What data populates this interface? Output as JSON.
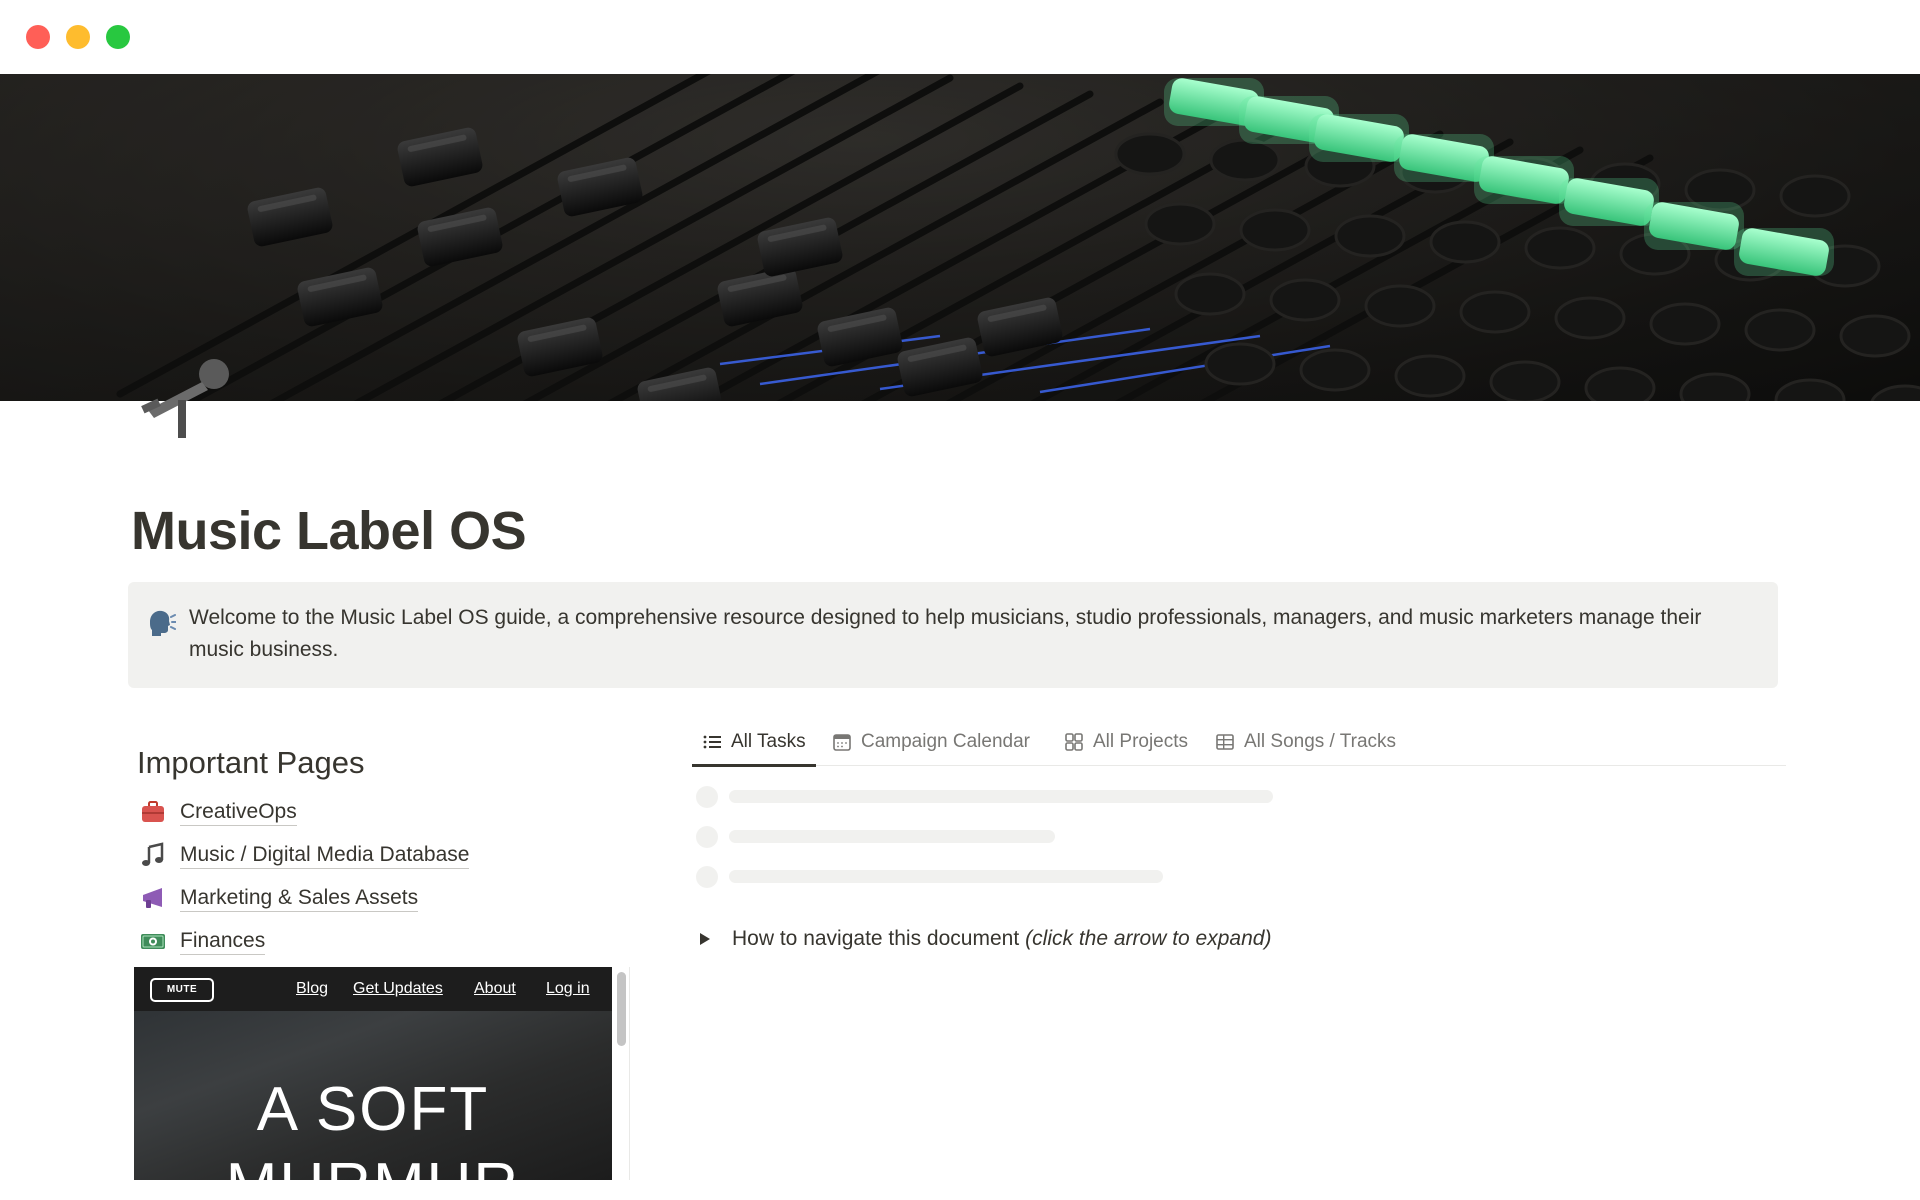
{
  "window": {
    "controls": [
      "close",
      "minimize",
      "zoom"
    ]
  },
  "cover": {
    "icon": "mixing-console-cover"
  },
  "page": {
    "icon": "microphone-icon",
    "title": "Music Label OS"
  },
  "callout": {
    "icon": "speaking-head-icon",
    "text": "Welcome to the Music Label OS guide, a comprehensive resource designed to help musicians, studio professionals, managers, and music marketers manage their music business."
  },
  "important_pages": {
    "heading": "Important Pages",
    "items": [
      {
        "icon": "briefcase-icon",
        "label": "CreativeOps"
      },
      {
        "icon": "musical-note-icon",
        "label": "Music / Digital Media Database"
      },
      {
        "icon": "megaphone-icon",
        "label": "Marketing & Sales Assets"
      },
      {
        "icon": "dollar-banknote-icon",
        "label": "Finances"
      }
    ]
  },
  "embed": {
    "logo": "MUTE",
    "nav": [
      "Blog",
      "Get Updates",
      "About",
      "Log in"
    ],
    "hero_line_1": "A SOFT",
    "hero_line_2": "MURMUR"
  },
  "tabs": [
    {
      "icon": "list-icon",
      "label": "All Tasks",
      "active": true
    },
    {
      "icon": "calendar-icon",
      "label": "Campaign Calendar",
      "active": false
    },
    {
      "icon": "gallery-icon",
      "label": "All Projects",
      "active": false
    },
    {
      "icon": "table-icon",
      "label": "All Songs / Tracks",
      "active": false
    }
  ],
  "toggle": {
    "text": "How to navigate this document",
    "hint": "(click the arrow to expand)"
  },
  "colors": {
    "text": "#37352f",
    "muted": "#787774",
    "callout_bg": "#f1f1ef",
    "skeleton": "#f1f1ef",
    "accent_green": "#5ee89a"
  }
}
